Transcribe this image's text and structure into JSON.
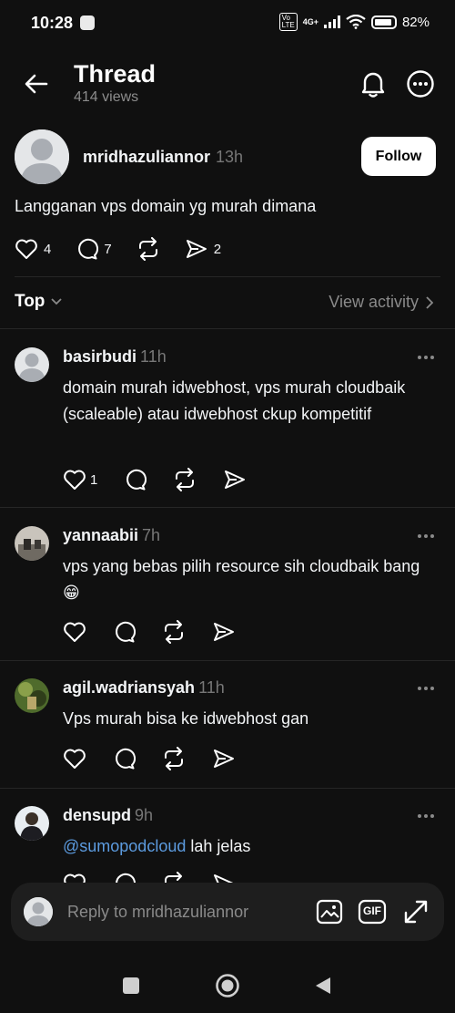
{
  "status": {
    "time": "10:28",
    "network": "4G+",
    "battery": "82%"
  },
  "header": {
    "title": "Thread",
    "views": "414 views"
  },
  "post": {
    "author": "mridhazuliannor",
    "time": "13h",
    "follow_label": "Follow",
    "text": "Langganan vps domain yg murah dimana",
    "likes": "4",
    "comments": "7",
    "shares": "2"
  },
  "sort": {
    "label": "Top",
    "view_activity": "View activity"
  },
  "replies": [
    {
      "author": "basirbudi",
      "time": "11h",
      "text": "domain murah idwebhost, vps murah cloudbaik (scaleable) atau idwebhost ckup kompetitif",
      "likes": "1"
    },
    {
      "author": "yannaabii",
      "time": "7h",
      "text": "vps yang bebas pilih resource sih cloudbaik bang 😁"
    },
    {
      "author": "agil.wadriansyah",
      "time": "11h",
      "text": "Vps murah bisa ke idwebhost gan"
    },
    {
      "author": "densupd",
      "time": "9h",
      "mention": "@sumopodcloud",
      "text": " lah jelas"
    }
  ],
  "composer": {
    "placeholder": "Reply to mridhazuliannor",
    "gif_label": "GIF"
  }
}
